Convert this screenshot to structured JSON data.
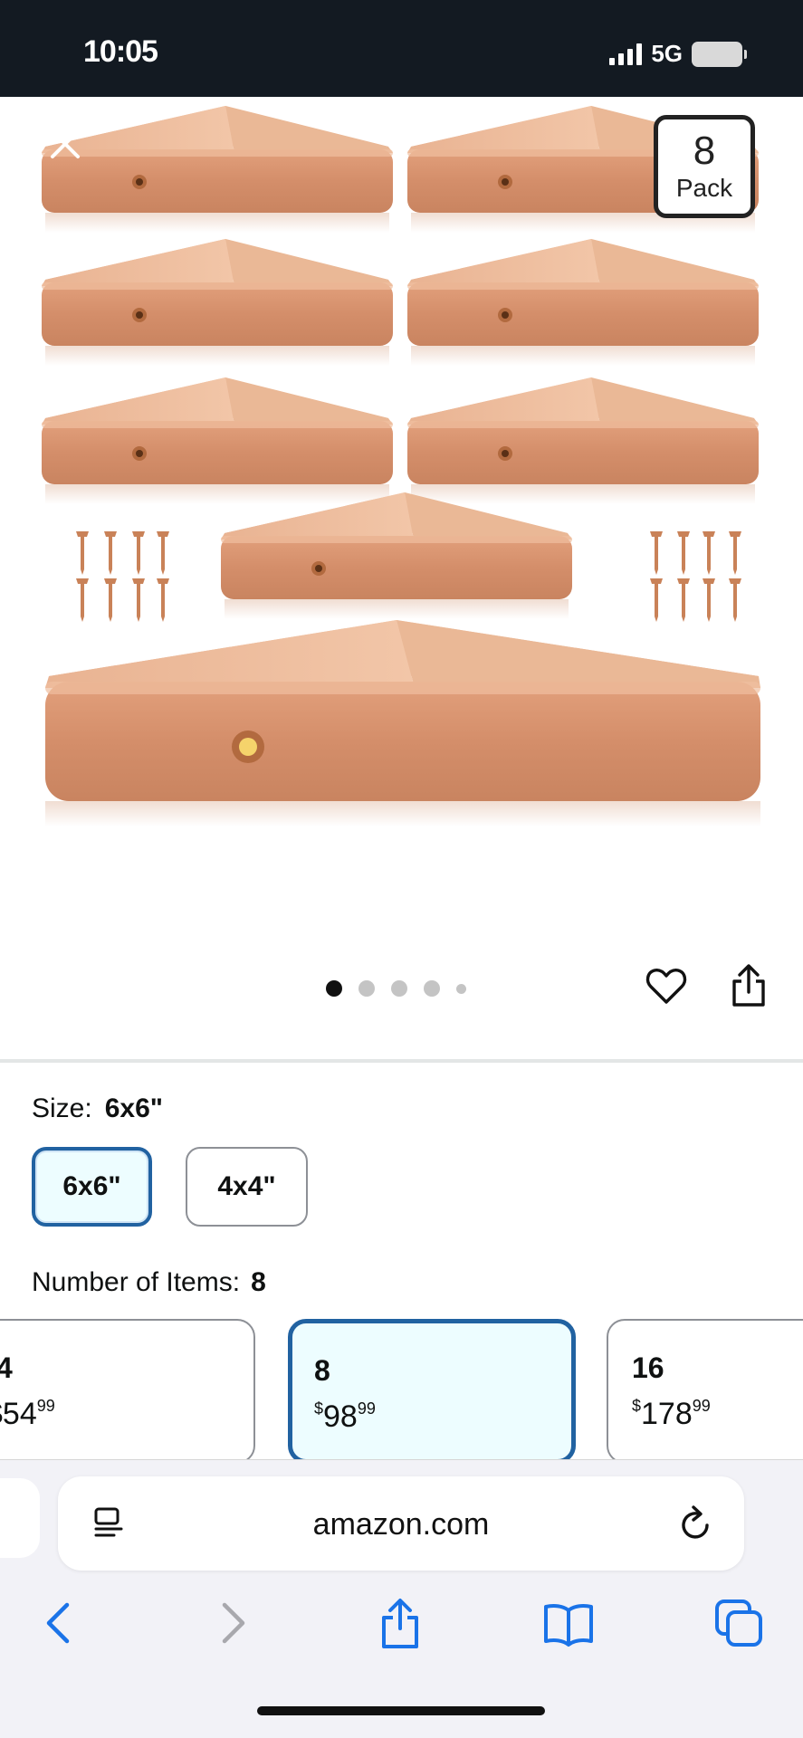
{
  "status_bar": {
    "time": "10:05",
    "network": "5G"
  },
  "gallery": {
    "pack_count": "8",
    "pack_label": "Pack",
    "image_count": 5,
    "active_index": 0,
    "icons": [
      "close-icon",
      "heart-icon",
      "share-icon"
    ],
    "product_color": "#d99a77"
  },
  "size": {
    "label": "Size:",
    "selected": "6x6\"",
    "options": [
      "6x6\"",
      "4x4\""
    ]
  },
  "items": {
    "label": "Number of Items:",
    "selected": "8",
    "options": [
      {
        "count": "4",
        "price_main": "54",
        "price_cents": "99"
      },
      {
        "count": "8",
        "price_main": "98",
        "price_cents": "99"
      },
      {
        "count": "16",
        "price_main": "178",
        "price_cents": "99"
      }
    ]
  },
  "browser": {
    "url": "amazon.com",
    "icons": [
      "reader-icon",
      "reload-icon",
      "back-icon",
      "forward-icon",
      "share-icon",
      "bookmarks-icon",
      "tabs-icon"
    ],
    "accent": "#1a73e8"
  },
  "colors": {
    "selected_border": "#2162a1",
    "selected_bg": "#edfdff",
    "status_bg": "#131a22"
  }
}
